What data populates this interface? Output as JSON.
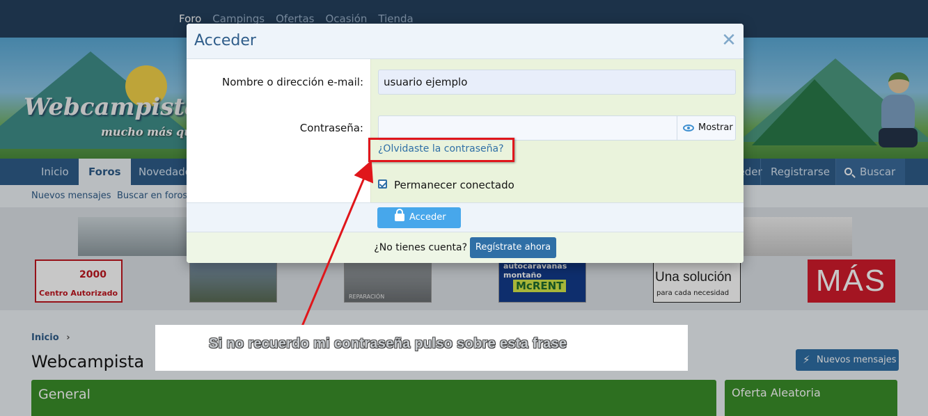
{
  "top_nav": [
    "Foro",
    "Campings",
    "Ofertas",
    "Ocasión",
    "Tienda"
  ],
  "banner": {
    "brand": "Webcampista.com",
    "tagline": "mucho más que un"
  },
  "main_nav": {
    "items": [
      "Inicio",
      "Foros",
      "Novedades"
    ],
    "right_items": [
      "Acceder",
      "Registrarse",
      "Buscar"
    ]
  },
  "sub_nav": [
    "Nuevos mensajes",
    "Buscar en foros"
  ],
  "ads": {
    "ad1_top": "2000",
    "ad1_bottom": "Centro Autorizado",
    "ad3_caption": "REPARACIÓN",
    "ad4_top": "autocaravanas montaño",
    "ad4_logo": "McRENT",
    "ad5_title": "Una solución",
    "ad5_sub": "para cada necesidad",
    "ad6_text": "MÁS"
  },
  "page": {
    "breadcrumb": "Inicio",
    "title": "Webcampista",
    "new_posts_button": "Nuevos mensajes",
    "section_title": "General",
    "sidebar_title": "Oferta Aleatoria"
  },
  "modal": {
    "title": "Acceder",
    "close_icon": "close-icon",
    "username_label": "Nombre o dirección e-mail:",
    "username_value": "usuario ejemplo",
    "password_label": "Contraseña:",
    "password_value": "",
    "show_button": "Mostrar",
    "forgot_link": "¿Olvidaste la contraseña?",
    "remember_label": "Permanecer conectado",
    "remember_checked": true,
    "submit_button": "Acceder",
    "no_account_text": "¿No tienes cuenta?",
    "register_button": "Regístrate ahora"
  },
  "annotation": {
    "callout_text": "Si no recuerdo mi contraseña pulso sobre esta frase",
    "highlight_color": "#e0161b"
  },
  "colors": {
    "accent": "#2f5d8a",
    "button_primary": "#47a7eb",
    "section_green": "#3a8f2a"
  }
}
